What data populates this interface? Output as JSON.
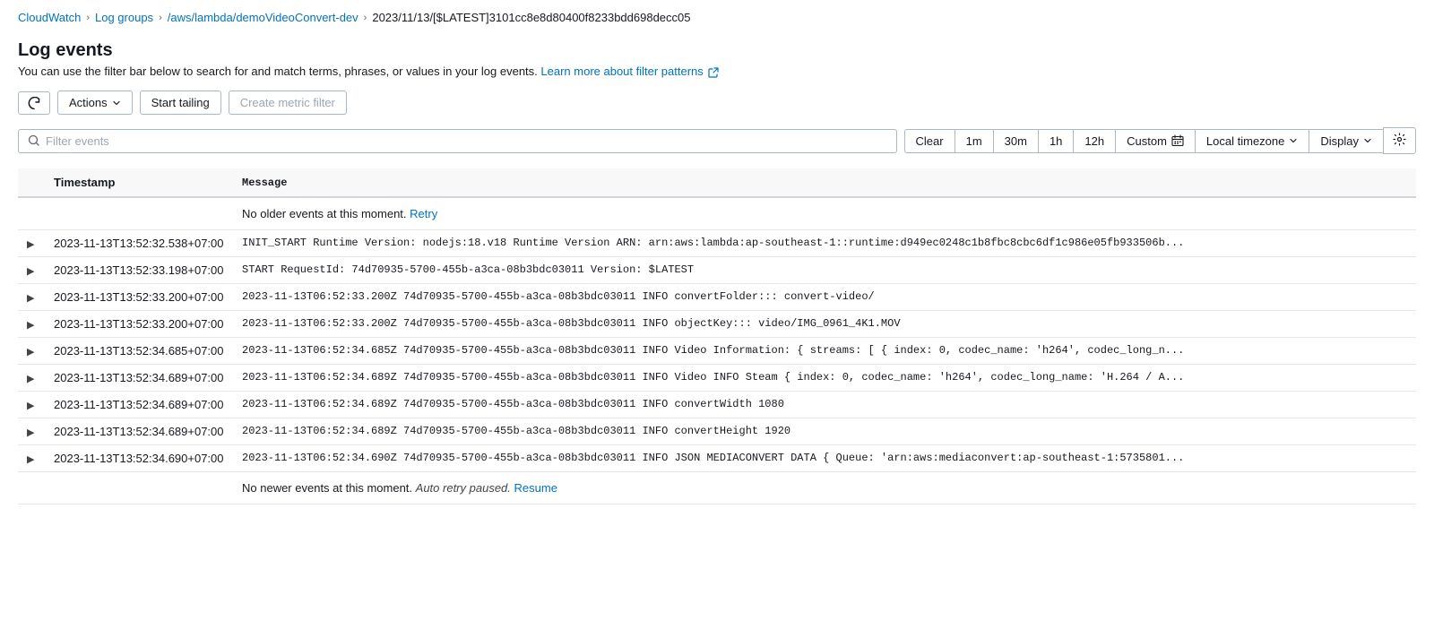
{
  "breadcrumb": {
    "items": [
      {
        "label": "CloudWatch",
        "link": true
      },
      {
        "label": "Log groups",
        "link": true
      },
      {
        "label": "/aws/lambda/demoVideoConvert-dev",
        "link": true
      },
      {
        "label": "2023/11/13/[$LATEST]3101cc8e8d80400f8233bdd698decc05",
        "link": false
      }
    ]
  },
  "page": {
    "title": "Log events",
    "description": "You can use the filter bar below to search for and match terms, phrases, or values in your log events.",
    "learn_more_label": "Learn more about filter patterns",
    "learn_more_link": "#"
  },
  "toolbar": {
    "refresh_label": "↺",
    "actions_label": "Actions",
    "start_tailing_label": "Start tailing",
    "create_metric_filter_label": "Create metric filter"
  },
  "filter_bar": {
    "placeholder": "Filter events",
    "clear_label": "Clear",
    "time_1m_label": "1m",
    "time_30m_label": "30m",
    "time_1h_label": "1h",
    "time_12h_label": "12h",
    "custom_label": "Custom",
    "timezone_label": "Local timezone",
    "display_label": "Display"
  },
  "table": {
    "col_expand": "",
    "col_timestamp": "Timestamp",
    "col_message": "Message",
    "no_older_events": "No older events at this moment.",
    "retry_label": "Retry",
    "no_newer_events": "No newer events at this moment.",
    "auto_retry_text": "Auto retry paused.",
    "resume_label": "Resume",
    "rows": [
      {
        "timestamp": "2023-11-13T13:52:32.538+07:00",
        "message": "INIT_START Runtime Version: nodejs:18.v18 Runtime Version ARN: arn:aws:lambda:ap-southeast-1::runtime:d949ec0248c1b8fbc8cbc6df1c986e05fb933506b..."
      },
      {
        "timestamp": "2023-11-13T13:52:33.198+07:00",
        "message": "START RequestId: 74d70935-5700-455b-a3ca-08b3bdc03011 Version: $LATEST"
      },
      {
        "timestamp": "2023-11-13T13:52:33.200+07:00",
        "message": "2023-11-13T06:52:33.200Z 74d70935-5700-455b-a3ca-08b3bdc03011 INFO convertFolder::: convert-video/"
      },
      {
        "timestamp": "2023-11-13T13:52:33.200+07:00",
        "message": "2023-11-13T06:52:33.200Z 74d70935-5700-455b-a3ca-08b3bdc03011 INFO objectKey::: video/IMG_0961_4K1.MOV"
      },
      {
        "timestamp": "2023-11-13T13:52:34.685+07:00",
        "message": "2023-11-13T06:52:34.685Z 74d70935-5700-455b-a3ca-08b3bdc03011 INFO Video Information: { streams: [ { index: 0, codec_name: 'h264', codec_long_n..."
      },
      {
        "timestamp": "2023-11-13T13:52:34.689+07:00",
        "message": "2023-11-13T06:52:34.689Z 74d70935-5700-455b-a3ca-08b3bdc03011 INFO Video INFO Steam { index: 0, codec_name: 'h264', codec_long_name: 'H.264 / A..."
      },
      {
        "timestamp": "2023-11-13T13:52:34.689+07:00",
        "message": "2023-11-13T06:52:34.689Z 74d70935-5700-455b-a3ca-08b3bdc03011 INFO convertWidth 1080"
      },
      {
        "timestamp": "2023-11-13T13:52:34.689+07:00",
        "message": "2023-11-13T06:52:34.689Z 74d70935-5700-455b-a3ca-08b3bdc03011 INFO convertHeight 1920"
      },
      {
        "timestamp": "2023-11-13T13:52:34.690+07:00",
        "message": "2023-11-13T06:52:34.690Z 74d70935-5700-455b-a3ca-08b3bdc03011 INFO JSON MEDIACONVERT DATA { Queue: 'arn:aws:mediaconvert:ap-southeast-1:5735801..."
      }
    ]
  }
}
